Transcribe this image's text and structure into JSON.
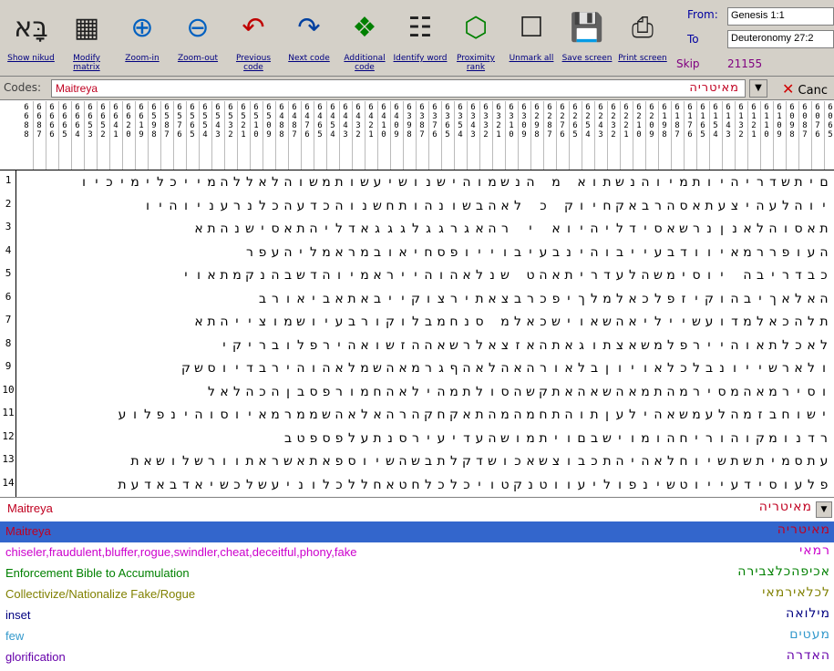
{
  "toolbar": {
    "buttons": [
      {
        "id": "show-nikud",
        "label": "Show nikud",
        "icon": "nikud-icon"
      },
      {
        "id": "modify-matrix",
        "label": "Modify matrix",
        "icon": "matrix-icon"
      },
      {
        "id": "zoom-in",
        "label": "Zoom-in",
        "icon": "zoom-in-icon"
      },
      {
        "id": "zoom-out",
        "label": "Zoom-out",
        "icon": "zoom-out-icon"
      },
      {
        "id": "previous-code",
        "label": "Previous code",
        "icon": "previous-arrow-icon"
      },
      {
        "id": "next-code",
        "label": "Next code",
        "icon": "next-arrow-icon"
      },
      {
        "id": "additional-code",
        "label": "Additional code",
        "icon": "additional-code-icon"
      },
      {
        "id": "identify-word",
        "label": "Identify word",
        "icon": "identify-word-icon"
      },
      {
        "id": "proximity-rank",
        "label": "Proximity rank",
        "icon": "proximity-icon"
      },
      {
        "id": "unmark-all",
        "label": "Unmark all",
        "icon": "unmark-icon"
      },
      {
        "id": "save-screen",
        "label": "Save screen",
        "icon": "save-disk-icon"
      },
      {
        "id": "print-screen",
        "label": "Print screen",
        "icon": "printer-icon"
      }
    ]
  },
  "range": {
    "from_label": "From:",
    "from_value": "Genesis 1:1",
    "to_label": "To",
    "to_value": "Deuteronomy 27:2",
    "skip_label": "Skip",
    "skip_value": "21155"
  },
  "codes": {
    "label": "Codes:",
    "value": "Maitreya",
    "hebrew": "מאיטריה",
    "cancel_label": "Canc"
  },
  "header_columns": [
    "6688",
    "6687",
    "6666",
    "6665",
    "6664",
    "6653",
    "6652",
    "6641",
    "6620",
    "6619",
    "6598",
    "6587",
    "6576",
    "6565",
    "6554",
    "6543",
    "6532",
    "6521",
    "6510",
    "6509",
    "6488",
    "6487",
    "6476",
    "6465",
    "6454",
    "6443",
    "6432",
    "6421",
    "6410",
    "6409",
    "6398",
    "6387",
    "6376",
    "6365",
    "6354",
    "6343",
    "6332",
    "6321",
    "6310",
    "6309",
    "6298",
    "6287",
    "6276",
    "6265",
    "6254",
    "6243",
    "6232",
    "6221",
    "6210",
    "6209",
    "6198",
    "6187",
    "6176",
    "6165",
    "6154",
    "6143",
    "6132",
    "6121",
    "6110",
    "6109",
    "6098",
    "6087",
    "6076",
    "6065"
  ],
  "rows": [
    "םיתשדריהיותמיוהנשתוא מ הנשמוהישנושיעשותמשוהלאללהמייכלימיכיו",
    "יוהלעהיצעתאסהרבאקחיוק כ לאהבשונהותחשנוהכדעהכלנרעניוהיו",
    "תאסוהלאנןנרשאסידליהיוא י רהאגרגגלגגגאדליהתאסישנהתא",
    "העופררמאיוודבעייבוהינבעיבוייופסחיאובמראמליהעפר",
    "כבדריבה יוסימשהלעדריתאהט שנלאהוהייראמיוהדשבהנקמתאוי",
    "האלאךיבהוקיזפלכאלמלךיפכרבצאתירצוקייבאתאביאורב",
    "תלהכאלמדועשייליאהשאוישכאלמ סנחמבלוקורבעיושמוצייהתא",
    "לאכלתאוהיירפלמשאצתוגאתהאזצאלרשאההזשואהירפלובריקי",
    "ולארשייונבלכלאויוןבלאורהאהלאהףגרמאהשמלאהוהירבדיוסשק",
    "וסירמאהמסירמהתמאהשאהאתקשהסולתמהילאהחמורפסבןהכהלאל",
    "ישוחבזמהלעמשאהילעןתוהתחמהמהתאקחקהרהאלאהשממרמאיוסוהינפלוע",
    "רדנומקוהוריחהומוישבםויתמושהעדיעירסנתעלפספטב",
    "עתסמיתשתשיוחלאהיהתכבוצשאכושדקלתבשהשיוספאתאשראתוורשלושאת",
    "פלעוסידעייוטשינפוליעווטנקטויכלכלחטאחללכלוניעשלכשיאדבאדעת"
  ],
  "selected_code": {
    "name": "Maitreya",
    "hebrew": "מאיטריה"
  },
  "legend": [
    {
      "text": "Maitreya",
      "hebrew": "מאיטריה",
      "color": "#c00020",
      "selected": true
    },
    {
      "text": "chiseler,fraudulent,bluffer,rogue,swindler,cheat,deceitful,phony,fake",
      "hebrew": "רמאי",
      "color": "#cc00cc",
      "selected": false
    },
    {
      "text": "Enforcement Bible to Accumulation",
      "hebrew": "אכיפהכלצבירה",
      "color": "#008000",
      "selected": false
    },
    {
      "text": "Collectivize/Nationalize Fake/Rogue",
      "hebrew": "לכלאירמאי",
      "color": "#808000",
      "selected": false
    },
    {
      "text": "inset",
      "hebrew": "מילואה",
      "color": "#000080",
      "selected": false
    },
    {
      "text": "few",
      "hebrew": "מעטים",
      "color": "#3399cc",
      "selected": false
    },
    {
      "text": "glorification",
      "hebrew": "האדרה",
      "color": "#6600aa",
      "selected": false
    }
  ],
  "colors": {
    "toolbar_bg": "#d4d0c8",
    "code_red": "#c00020",
    "selection_blue": "#3366cc"
  }
}
